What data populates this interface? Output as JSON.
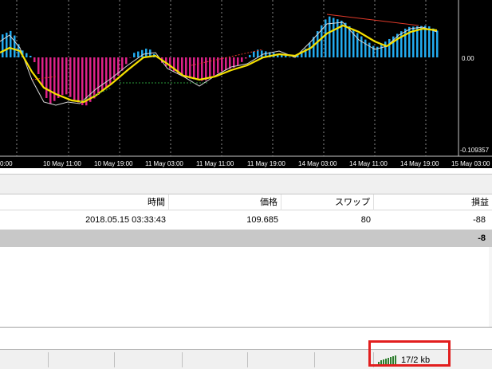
{
  "chart": {
    "price_labels": [
      "0.00",
      "-0.109357"
    ],
    "time_labels": [
      "0:00",
      "10 May 11:00",
      "10 May 19:00",
      "11 May 03:00",
      "11 May 11:00",
      "11 May 19:00",
      "14 May 03:00",
      "14 May 11:00",
      "14 May 19:00",
      "15 May 03:00"
    ],
    "colors": {
      "background": "#000000",
      "histogram_up": "#22aaee",
      "histogram_down": "#dd2288",
      "signal_line": "#f5e000",
      "trend_line": "#e03a2a",
      "grid": "#8a8a8a"
    }
  },
  "trade_table": {
    "headers": {
      "time": "時間",
      "price": "価格",
      "swap": "スワップ",
      "profit": "損益"
    },
    "rows": [
      {
        "time": "2018.05.15 03:33:43",
        "price": "109.685",
        "swap": "80",
        "profit": "-88"
      }
    ],
    "total_profit": "-8"
  },
  "status_bar": {
    "connection_traffic": "17/2 kb",
    "connection_icon": "connection-bars-icon",
    "highlight_color": "#e21e1e"
  }
}
